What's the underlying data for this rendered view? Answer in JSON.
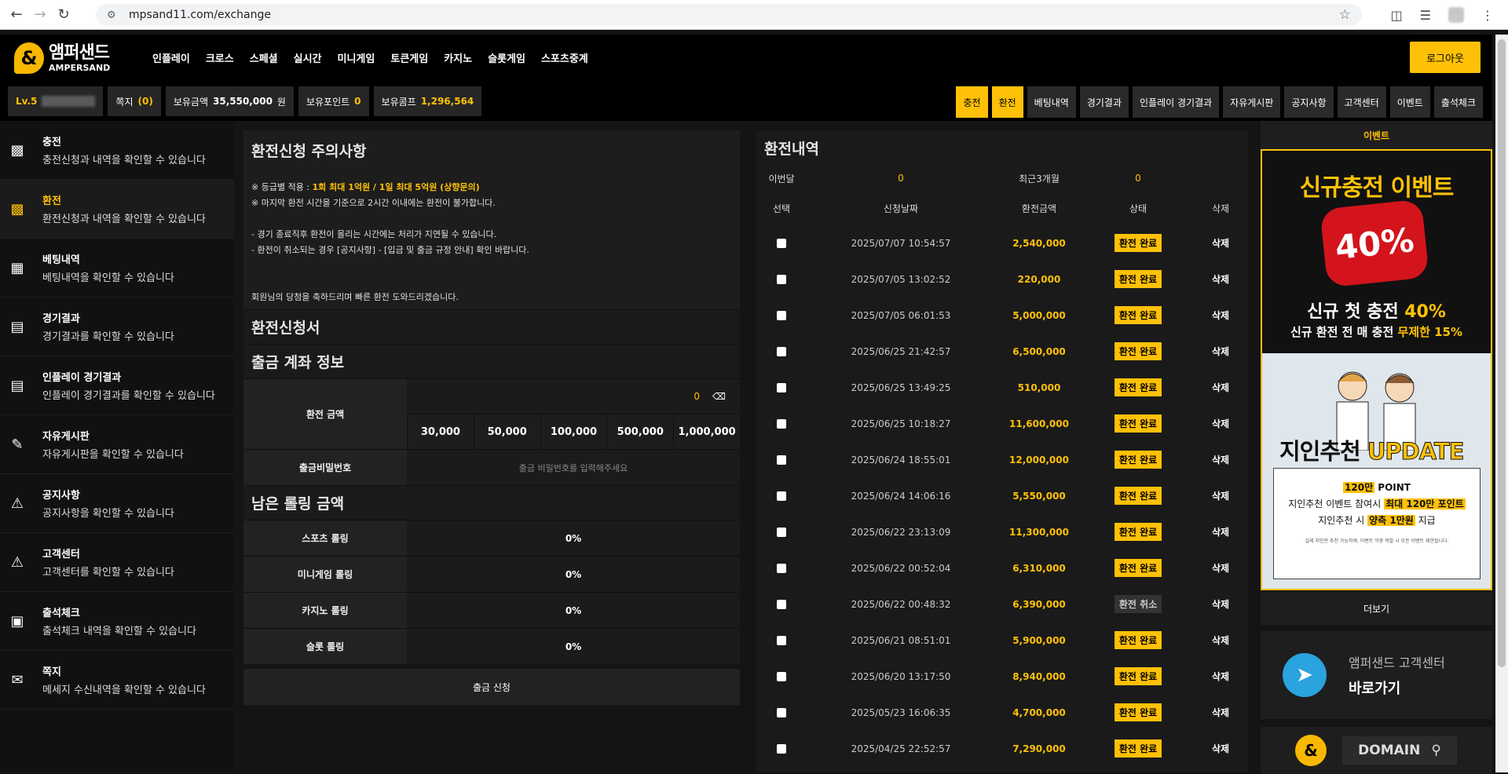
{
  "browser": {
    "url": "mpsand11.com/exchange"
  },
  "header": {
    "logo_ko": "앰퍼샌드",
    "logo_en": "AMPERSAND",
    "menu": [
      "인플레이",
      "크로스",
      "스페셜",
      "실시간",
      "미니게임",
      "토큰게임",
      "카지노",
      "슬롯게임",
      "스포츠중계"
    ],
    "logout": "로그아웃"
  },
  "infobar": {
    "level": "Lv.5",
    "note_label": "쪽지",
    "note_count": "(0)",
    "balance_label": "보유금액",
    "balance_value": "35,550,000",
    "balance_unit": "원",
    "point_label": "보유포인트",
    "point_value": "0",
    "comp_label": "보유콤프",
    "comp_value": "1,296,564",
    "tabs": [
      "충전",
      "환전",
      "베팅내역",
      "경기결과",
      "인플레이 경기결과",
      "자유게시판",
      "공지사항",
      "고객센터",
      "이벤트",
      "출석체크"
    ]
  },
  "sidebar": {
    "items": [
      {
        "title": "충전",
        "desc": "충전신청과 내역을 확인할 수 있습니다",
        "icon": "money-icon"
      },
      {
        "title": "환전",
        "desc": "환전신청과 내역을 확인할 수 있습니다",
        "icon": "money-icon"
      },
      {
        "title": "베팅내역",
        "desc": "베팅내역을 확인할 수 있습니다",
        "icon": "podium-icon"
      },
      {
        "title": "경기결과",
        "desc": "경기결과를 확인할 수 있습니다",
        "icon": "calendar-icon"
      },
      {
        "title": "인플레이 경기결과",
        "desc": "인플레이 경기결과를 확인할 수 있습니다",
        "icon": "calendar-icon"
      },
      {
        "title": "자유게시판",
        "desc": "자유게시판을 확인할 수 있습니다",
        "icon": "pencil-icon"
      },
      {
        "title": "공지사항",
        "desc": "공지사항을 확인할 수 있습니다",
        "icon": "alert-icon"
      },
      {
        "title": "고객센터",
        "desc": "고객센터를 확인할 수 있습니다",
        "icon": "alert-icon"
      },
      {
        "title": "출석체크",
        "desc": "출석체크 내역을 확인할 수 있습니다",
        "icon": "badge-icon"
      },
      {
        "title": "쪽지",
        "desc": "메세지 수신내역을 확인할 수 있습니다",
        "icon": "mail-icon"
      }
    ]
  },
  "notice": {
    "title": "환전신청 주의사항",
    "line1_a": "※ 등급별 적용 : ",
    "line1_b": "1회 최대 1억원 / 1일 최대 5억원 (상향문의)",
    "line2": "※ 마지막 환전 시간을 기준으로 2시간 이내에는 환전이 불가합니다.",
    "line3": "- 경기 종료직후 환전이 몰리는 시간에는 처리가 지연될 수 있습니다.",
    "line4": "- 환전이 취소되는 경우 [공지사항] - [입금 및 출금 규정 안내] 확인 바랍니다.",
    "line5": "회원님의 당첨을 축하드리며 빠른 환전 도와드리겠습니다."
  },
  "form": {
    "title": "환전신청서",
    "account_title": "출금 계좌 정보",
    "amount_label": "환전 금액",
    "amount_value": "0",
    "amount_buttons": [
      "30,000",
      "50,000",
      "100,000",
      "500,000",
      "1,000,000"
    ],
    "password_label": "출금비밀번호",
    "password_placeholder": "출금 비밀번호를 입력해주세요",
    "rolling_title": "남은 롤링 금액",
    "rolling": [
      {
        "label": "스포츠 롤링",
        "value": "0%"
      },
      {
        "label": "미니게임 롤링",
        "value": "0%"
      },
      {
        "label": "카지노 롤링",
        "value": "0%"
      },
      {
        "label": "슬롯 롤링",
        "value": "0%"
      }
    ],
    "submit": "출금 신청"
  },
  "history": {
    "title": "환전내역",
    "month_label": "이번달",
    "month_value": "0",
    "recent_label": "최근3개월",
    "recent_value": "0",
    "headers": [
      "선택",
      "신청날짜",
      "환전금액",
      "상태",
      "삭제"
    ],
    "rows": [
      {
        "date": "2025/07/07 10:54:57",
        "amount": "2,540,000",
        "status": "환전 완료",
        "cancel": false
      },
      {
        "date": "2025/07/05 13:02:52",
        "amount": "220,000",
        "status": "환전 완료",
        "cancel": false
      },
      {
        "date": "2025/07/05 06:01:53",
        "amount": "5,000,000",
        "status": "환전 완료",
        "cancel": false
      },
      {
        "date": "2025/06/25 21:42:57",
        "amount": "6,500,000",
        "status": "환전 완료",
        "cancel": false
      },
      {
        "date": "2025/06/25 13:49:25",
        "amount": "510,000",
        "status": "환전 완료",
        "cancel": false
      },
      {
        "date": "2025/06/25 10:18:27",
        "amount": "11,600,000",
        "status": "환전 완료",
        "cancel": false
      },
      {
        "date": "2025/06/24 18:55:01",
        "amount": "12,000,000",
        "status": "환전 완료",
        "cancel": false
      },
      {
        "date": "2025/06/24 14:06:16",
        "amount": "5,550,000",
        "status": "환전 완료",
        "cancel": false
      },
      {
        "date": "2025/06/22 23:13:09",
        "amount": "11,300,000",
        "status": "환전 완료",
        "cancel": false
      },
      {
        "date": "2025/06/22 00:52:04",
        "amount": "6,310,000",
        "status": "환전 완료",
        "cancel": false
      },
      {
        "date": "2025/06/22 00:48:32",
        "amount": "6,390,000",
        "status": "환전 취소",
        "cancel": true
      },
      {
        "date": "2025/06/21 08:51:01",
        "amount": "5,900,000",
        "status": "환전 완료",
        "cancel": false
      },
      {
        "date": "2025/06/20 13:17:50",
        "amount": "8,940,000",
        "status": "환전 완료",
        "cancel": false
      },
      {
        "date": "2025/05/23 16:06:35",
        "amount": "4,700,000",
        "status": "환전 완료",
        "cancel": false
      },
      {
        "date": "2025/04/25 22:52:57",
        "amount": "7,290,000",
        "status": "환전 완료",
        "cancel": false
      }
    ],
    "delete_label": "삭제"
  },
  "right": {
    "event_title": "이벤트",
    "banner1_title": "신규충전 이벤트",
    "banner1_pct": "40%",
    "banner1_sub1_a": "신규 첫 충전 ",
    "banner1_sub1_b": "40%",
    "banner1_sub2_a": "신규 환전 전 매 충전 ",
    "banner1_sub2_b": "무제한 15%",
    "banner2_a": "지인추천 ",
    "banner2_b": "UPDATE",
    "banner2_line1_a": "120만",
    "banner2_line1_b": " POINT",
    "banner2_line2_a": "지인추천 이벤트 참여시 ",
    "banner2_line2_b": "최대 120만 포인트",
    "banner2_line3_a": "지인추천 시 ",
    "banner2_line3_b": "양측 1만원",
    "banner2_line3_c": " 지급",
    "banner2_tiny": "실제 지인만 추천 가능하며, 이벤트 악용 적발 시 모든 이벤트 제한됩니다.",
    "more": "더보기",
    "tg_line1": "앰퍼샌드 고객센터",
    "tg_line2": "바로가기",
    "domain": "DOMAIN"
  }
}
